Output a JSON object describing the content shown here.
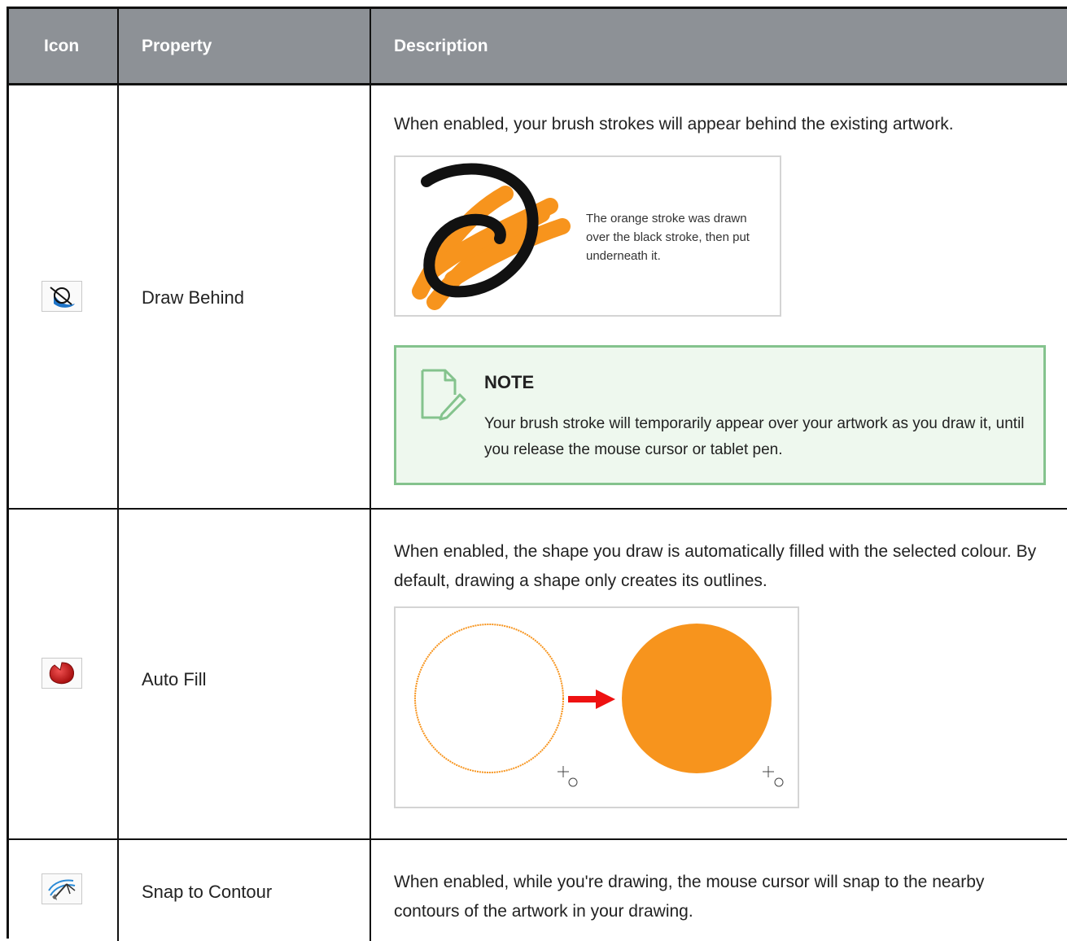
{
  "header": {
    "icon": "Icon",
    "property": "Property",
    "description": "Description"
  },
  "rows": [
    {
      "icon": "draw-behind-icon",
      "property": "Draw Behind",
      "description": "When enabled, your brush strokes will appear behind the existing artwork.",
      "figure_caption": [
        "The orange stroke was drawn",
        "over the black stroke, then put",
        "underneath it."
      ],
      "note": {
        "title": "NOTE",
        "body": "Your brush stroke will temporarily appear over your artwork as you draw it, until you release the mouse cursor or tablet pen."
      }
    },
    {
      "icon": "auto-fill-icon",
      "property": "Auto Fill",
      "description": "When enabled, the shape you draw is automatically filled with the selected colour. By default, drawing a shape only creates its outlines."
    },
    {
      "icon": "snap-to-contour-icon",
      "property": "Snap to Contour",
      "description": "When enabled, while you're drawing, the mouse cursor will snap to the nearby contours of the artwork in your drawing."
    }
  ],
  "colors": {
    "header_bg": "#8d9196",
    "note_bg": "#eef8ee",
    "note_border": "#84c38d",
    "orange": "#f7941d",
    "arrow_red": "#ee1111"
  }
}
